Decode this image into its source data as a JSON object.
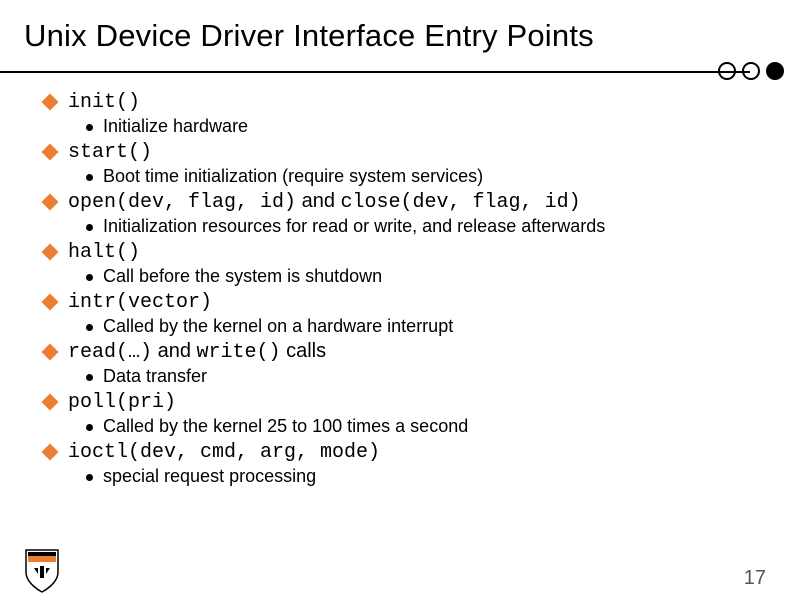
{
  "title": "Unix Device Driver Interface Entry Points",
  "items": [
    {
      "code": "init()",
      "desc": "Initialize hardware"
    },
    {
      "code": "start()",
      "desc": "Boot time initialization (require system services)"
    },
    {
      "code_parts": [
        "open(dev, flag, id)",
        " and ",
        "close(dev, flag, id)"
      ],
      "desc": "Initialization resources for read or write, and release afterwards"
    },
    {
      "code": "halt()",
      "desc": "Call before the system is shutdown"
    },
    {
      "code": "intr(vector)",
      "desc": "Called by the kernel on a hardware interrupt"
    },
    {
      "code_parts": [
        "read(…)",
        " and ",
        "write()",
        " calls"
      ],
      "desc": "Data transfer"
    },
    {
      "code": "poll(pri)",
      "desc": "Called by the kernel 25 to 100 times a second"
    },
    {
      "code": "ioctl(dev, cmd, arg, mode)",
      "desc": "special request processing"
    }
  ],
  "page_number": "17"
}
